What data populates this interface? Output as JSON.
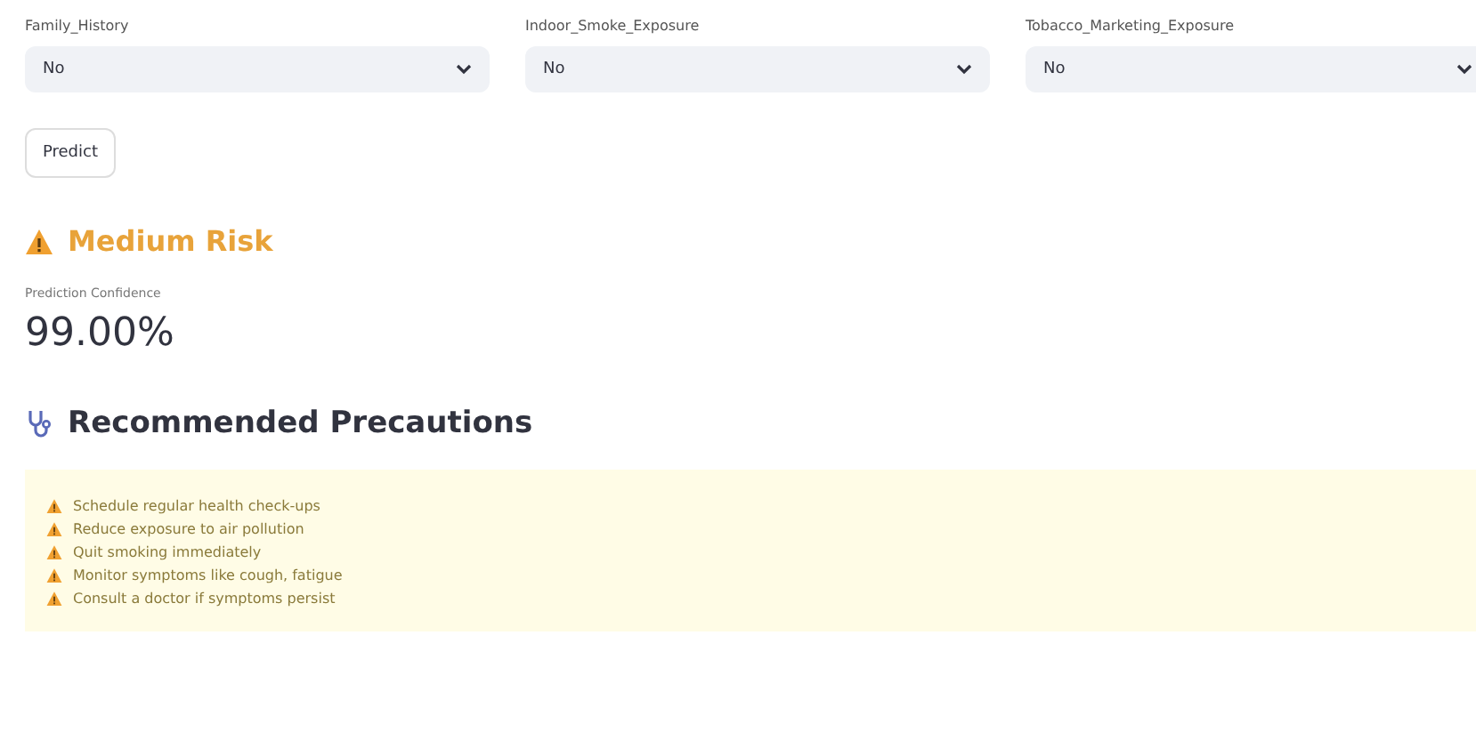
{
  "selects": [
    {
      "label": "Family_History",
      "value": "No"
    },
    {
      "label": "Indoor_Smoke_Exposure",
      "value": "No"
    },
    {
      "label": "Tobacco_Marketing_Exposure",
      "value": "No"
    }
  ],
  "predict_button": "Predict",
  "result": {
    "kind": "warning",
    "title": "Medium Risk"
  },
  "metric": {
    "label": "Prediction Confidence",
    "value": "99.00%"
  },
  "precautions": {
    "title": "Recommended Precautions",
    "items": [
      "Schedule regular health check-ups",
      "Reduce exposure to air pollution",
      "Quit smoking immediately",
      "Monitor symptoms like cough, fatigue",
      "Consult a doctor if symptoms persist"
    ]
  }
}
